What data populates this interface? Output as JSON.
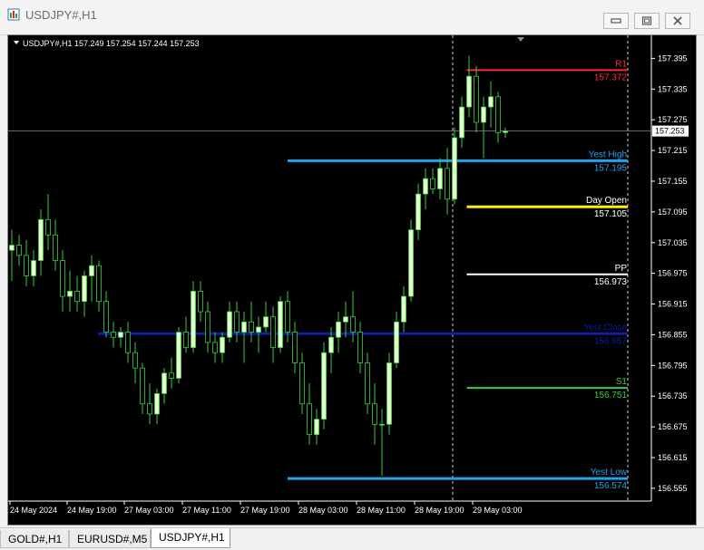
{
  "window": {
    "title": "USDJPY#,H1"
  },
  "chart": {
    "header": "USDJPY#,H1  157.249 157.254 157.244 157.253",
    "current_price": "157.253",
    "ylim": [
      156.53,
      157.44
    ],
    "price_ticks": [
      "157.395",
      "157.335",
      "157.275",
      "157.215",
      "157.155",
      "157.095",
      "157.035",
      "156.975",
      "156.915",
      "156.855",
      "156.795",
      "156.735",
      "156.675",
      "156.615",
      "156.555"
    ],
    "time_labels": [
      "24 May 2024",
      "24 May 19:00",
      "27 May 03:00",
      "27 May 11:00",
      "27 May 19:00",
      "28 May 03:00",
      "28 May 11:00",
      "28 May 19:00",
      "29 May 03:00"
    ],
    "levels": [
      {
        "label": "R1",
        "value_text": "157.372",
        "value": 157.372,
        "color": "#ff2b2b",
        "label_color": "#ff2b2b",
        "start_fraction": 0.714
      },
      {
        "label": "Yest High",
        "value_text": "157.195",
        "value": 157.195,
        "color": "#1fa4f0",
        "label_color": "#1fa4f0",
        "start_fraction": 0.435
      },
      {
        "label": "Day Open",
        "value_text": "157.105",
        "value": 157.105,
        "color": "#ffee00",
        "label_color": "#ffffff",
        "start_fraction": 0.714
      },
      {
        "label": "PP",
        "value_text": "156.973",
        "value": 156.973,
        "color": "#ffffff",
        "label_color": "#ffffff",
        "start_fraction": 0.714
      },
      {
        "label": "Yest Close",
        "value_text": "156.857",
        "value": 156.857,
        "color": "#0b1fa8",
        "label_color": "#0b1fa8",
        "start_fraction": 0.14
      },
      {
        "label": "S1",
        "value_text": "156.751",
        "value": 156.751,
        "color": "#3ccd3c",
        "label_color": "#3ccd3c",
        "start_fraction": 0.714
      },
      {
        "label": "Yest Low",
        "value_text": "156.574",
        "value": 156.574,
        "color": "#1fa4f0",
        "label_color": "#1fa4f0",
        "start_fraction": 0.435
      }
    ],
    "colors": {
      "bull": "#e8ffd0",
      "bear": "#000000",
      "wick": "#3ccd3c",
      "outline": "#3ccd3c"
    }
  },
  "chart_data": {
    "type": "candlestick",
    "symbol": "USDJPY#",
    "timeframe": "H1",
    "ylim": [
      156.53,
      157.44
    ],
    "ohlc": [
      [
        157.02,
        157.06,
        156.96,
        157.03
      ],
      [
        157.03,
        157.05,
        156.99,
        157.01
      ],
      [
        157.01,
        157.04,
        156.95,
        156.97
      ],
      [
        156.97,
        157.02,
        156.95,
        157.0
      ],
      [
        157.0,
        157.1,
        156.97,
        157.08
      ],
      [
        157.08,
        157.13,
        157.02,
        157.05
      ],
      [
        157.05,
        157.08,
        156.98,
        157.0
      ],
      [
        157.0,
        157.02,
        156.9,
        156.93
      ],
      [
        156.93,
        156.98,
        156.9,
        156.94
      ],
      [
        156.94,
        156.97,
        156.9,
        156.92
      ],
      [
        156.92,
        156.98,
        156.89,
        156.97
      ],
      [
        156.97,
        157.01,
        156.92,
        156.99
      ],
      [
        156.99,
        157.0,
        156.9,
        156.92
      ],
      [
        156.92,
        156.94,
        156.85,
        156.86
      ],
      [
        156.86,
        156.88,
        156.83,
        156.85
      ],
      [
        156.85,
        156.87,
        156.83,
        156.86
      ],
      [
        156.86,
        156.88,
        156.8,
        156.82
      ],
      [
        156.82,
        156.84,
        156.76,
        156.79
      ],
      [
        156.79,
        156.8,
        156.7,
        156.72
      ],
      [
        156.72,
        156.76,
        156.68,
        156.7
      ],
      [
        156.7,
        156.75,
        156.68,
        156.74
      ],
      [
        156.74,
        156.79,
        156.72,
        156.78
      ],
      [
        156.78,
        156.81,
        156.75,
        156.77
      ],
      [
        156.77,
        156.87,
        156.76,
        156.86
      ],
      [
        156.86,
        156.89,
        156.82,
        156.83
      ],
      [
        156.83,
        156.96,
        156.82,
        156.94
      ],
      [
        156.94,
        156.96,
        156.88,
        156.9
      ],
      [
        156.9,
        156.92,
        156.82,
        156.84
      ],
      [
        156.84,
        156.86,
        156.8,
        156.82
      ],
      [
        156.82,
        156.86,
        156.8,
        156.85
      ],
      [
        156.85,
        156.92,
        156.84,
        156.9
      ],
      [
        156.9,
        156.92,
        156.84,
        156.86
      ],
      [
        156.86,
        156.9,
        156.8,
        156.88
      ],
      [
        156.88,
        156.92,
        156.84,
        156.86
      ],
      [
        156.86,
        156.89,
        156.82,
        156.87
      ],
      [
        156.87,
        156.92,
        156.86,
        156.89
      ],
      [
        156.89,
        156.91,
        156.8,
        156.83
      ],
      [
        156.83,
        156.93,
        156.82,
        156.92
      ],
      [
        156.92,
        156.94,
        156.84,
        156.86
      ],
      [
        156.86,
        156.88,
        156.78,
        156.8
      ],
      [
        156.8,
        156.82,
        156.7,
        156.72
      ],
      [
        156.72,
        156.76,
        156.64,
        156.66
      ],
      [
        156.66,
        156.71,
        156.64,
        156.69
      ],
      [
        156.69,
        156.84,
        156.67,
        156.82
      ],
      [
        156.82,
        156.87,
        156.78,
        156.85
      ],
      [
        156.85,
        156.9,
        156.82,
        156.88
      ],
      [
        156.88,
        156.92,
        156.85,
        156.89
      ],
      [
        156.89,
        156.94,
        156.84,
        156.86
      ],
      [
        156.86,
        156.88,
        156.78,
        156.8
      ],
      [
        156.8,
        156.82,
        156.7,
        156.72
      ],
      [
        156.72,
        156.76,
        156.64,
        156.68
      ],
      [
        156.68,
        156.71,
        156.58,
        156.68
      ],
      [
        156.68,
        156.82,
        156.66,
        156.8
      ],
      [
        156.8,
        156.9,
        156.79,
        156.88
      ],
      [
        156.88,
        156.95,
        156.86,
        156.93
      ],
      [
        156.93,
        157.08,
        156.92,
        157.06
      ],
      [
        157.06,
        157.15,
        157.04,
        157.13
      ],
      [
        157.13,
        157.18,
        157.1,
        157.16
      ],
      [
        157.16,
        157.18,
        157.13,
        157.14
      ],
      [
        157.14,
        157.2,
        157.12,
        157.18
      ],
      [
        157.18,
        157.22,
        157.09,
        157.12
      ],
      [
        157.12,
        157.26,
        157.11,
        157.24
      ],
      [
        157.24,
        157.32,
        157.22,
        157.3
      ],
      [
        157.3,
        157.4,
        157.28,
        157.36
      ],
      [
        157.36,
        157.38,
        157.25,
        157.27
      ],
      [
        157.27,
        157.32,
        157.2,
        157.3
      ],
      [
        157.3,
        157.35,
        157.26,
        157.32
      ],
      [
        157.32,
        157.33,
        157.23,
        157.25
      ],
      [
        157.25,
        157.26,
        157.24,
        157.253
      ]
    ]
  },
  "tabs": [
    {
      "label": "GOLD#,H1",
      "active": false
    },
    {
      "label": "EURUSD#,M5",
      "active": false
    },
    {
      "label": "USDJPY#,H1",
      "active": true
    }
  ]
}
